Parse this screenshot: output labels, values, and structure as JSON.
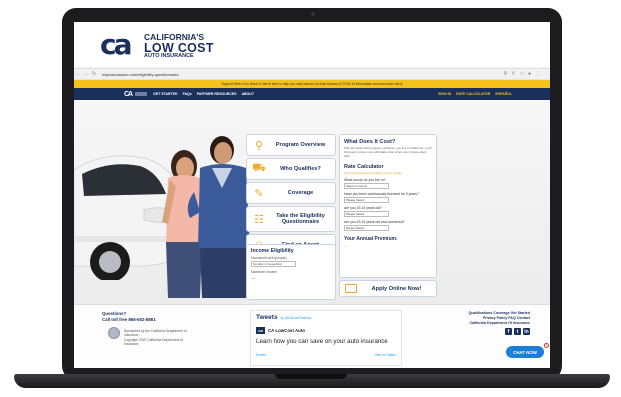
{
  "header": {
    "logo_mark": "ca",
    "logo_line1": "CALIFORNIA'S",
    "logo_line2": "LOW COST",
    "logo_line3": "AUTO INSURANCE"
  },
  "browser": {
    "url": "mylowcostauto.com/eligibility-questionnaire",
    "back_icon": "arrow-left-icon",
    "forward_icon": "arrow-right-icon",
    "reload_icon": "reload-icon"
  },
  "alert": {
    "text": "Support When You Need It: We're here to help you stay insured for Auto Access (COVID-19 information and resources here)"
  },
  "nav": {
    "logo": "CA",
    "items": [
      "GET STARTED",
      "FAQs",
      "PARTNER RESOURCES",
      "ABOUT"
    ],
    "right_items": [
      "SIGN IN",
      "RATE CALCULATOR",
      "ESPAÑOL"
    ]
  },
  "cards": [
    {
      "label": "Program Overview",
      "icon": "magnifier-icon"
    },
    {
      "label": "Who Qualifies?",
      "icon": "car-icon"
    },
    {
      "label": "Coverage",
      "icon": "pen-icon"
    },
    {
      "label": "Take the Eligibility Questionnaire",
      "icon": "clipboard-icon"
    },
    {
      "label": "Find an Agent",
      "icon": "agent-icon"
    }
  ],
  "income": {
    "title": "Income Eligibility",
    "household_label": "Household size (people)",
    "household_select": "Number in household",
    "max_income_label": "Maximum Income",
    "max_income_value": "---"
  },
  "cost": {
    "title": "What Does It Cost?",
    "body": "With the state-wide program, whatever you live in California, you'll find lower prices more affordable than what most private plans offer.",
    "rc_title": "Rate Calculator",
    "rc_note": "Find out the annual premium in your county.",
    "q1": "What county do you live in?",
    "q1_select": "Select a County",
    "q2": "Have you been continuously licensed for 3 years?",
    "q2_select": "Please Select",
    "q3": "Are you 19-24 years old?",
    "q3_select": "Please Select",
    "q4": "Are you 19-24 years old and unmarried?",
    "q4_select": "Please Select",
    "premium_title": "Your Annual Premium:",
    "premium_value": "---"
  },
  "apply": {
    "label": "Apply Online Now!"
  },
  "footer": {
    "questions": "Questions?",
    "call": "Call toll free 866-602-8861",
    "sponsor": "Sponsored by the California Department of Insurance",
    "sponsor2": "Copyright 2022 California Department of Insurance",
    "tweets_title": "Tweets",
    "tweets_by": "by @CALowCostAuto",
    "tweet_account": "CA LowCost Auto",
    "tweet_handle": "@CALowCostAuto",
    "tweet_text": "Learn how you can save on your auto insurance",
    "embed": "Embed",
    "view_on_twitter": "View on Twitter",
    "links1": "Qualifications   Coverage   Get Started",
    "links2": "Privacy Policy   FAQ   Contact",
    "links3": "California Department Of Insurance",
    "social": [
      "f",
      "t",
      "in"
    ]
  },
  "chat": {
    "label": "CHAT NOW",
    "close": "x"
  }
}
